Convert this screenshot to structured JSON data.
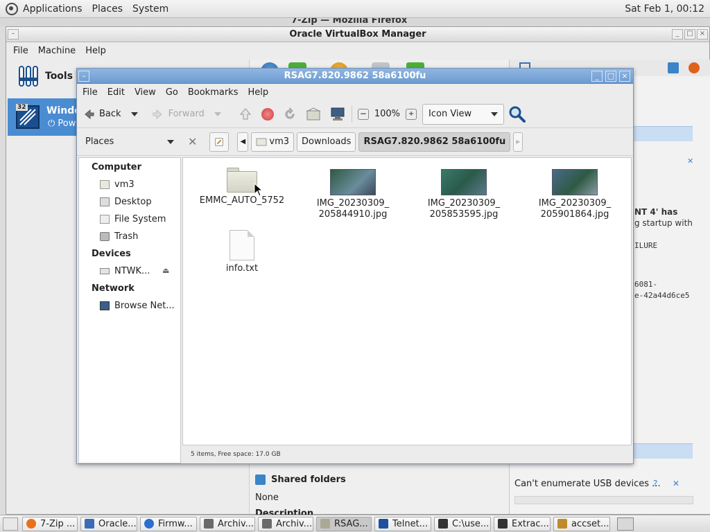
{
  "top_panel": {
    "menus": [
      "Applications",
      "Places",
      "System"
    ],
    "clock": "Sat Feb 1, 00:12"
  },
  "bg_firefox_title": "7-Zip — Mozilla Firefox",
  "vbox": {
    "title": "Oracle VirtualBox Manager",
    "menus": [
      "File",
      "Machine",
      "Help"
    ],
    "tools_label": "Tools",
    "vm": {
      "name": "Windov",
      "state": "Pow",
      "badge": "32"
    },
    "shared_folders_label": "Shared folders",
    "shared_folders_value": "None",
    "description_label": "Description",
    "right_note_1": "NT 4' has",
    "right_note_2": "g startup with",
    "mono_1": "ILURE",
    "mono_2": "6081-",
    "mono_3": "e-42a44d6ce5",
    "usb_message": "Can't enumerate USB devices ..."
  },
  "fm": {
    "title": "RSAG7.820.9862 58a6100fu",
    "menus": [
      "File",
      "Edit",
      "View",
      "Go",
      "Bookmarks",
      "Help"
    ],
    "toolbar": {
      "back": "Back",
      "forward": "Forward",
      "zoom": "100%",
      "view_mode": "Icon View"
    },
    "location": {
      "places_label": "Places",
      "crumbs": [
        "vm3",
        "Downloads",
        "RSAG7.820.9862 58a6100fu"
      ]
    },
    "sidebar": {
      "computer_header": "Computer",
      "computer_items": [
        "vm3",
        "Desktop",
        "File System",
        "Trash"
      ],
      "devices_header": "Devices",
      "devices_items": [
        "NTWK..."
      ],
      "network_header": "Network",
      "network_items": [
        "Browse Net..."
      ]
    },
    "items": [
      {
        "name_1": "EMMC_AUTO_5752",
        "name_2": "",
        "type": "folder"
      },
      {
        "name_1": "IMG_20230309_",
        "name_2": "205844910.jpg",
        "type": "image"
      },
      {
        "name_1": "IMG_20230309_",
        "name_2": "205853595.jpg",
        "type": "image"
      },
      {
        "name_1": "IMG_20230309_",
        "name_2": "205901864.jpg",
        "type": "image"
      },
      {
        "name_1": "info.txt",
        "name_2": "",
        "type": "text"
      }
    ],
    "status": "5 items, Free space: 17.0 GB"
  },
  "taskbar": {
    "tasks": [
      "7-Zip ...",
      "Oracle...",
      "Firmw...",
      "Archiv...",
      "Archiv...",
      "RSAG...",
      "Telnet...",
      "C:\\use...",
      "Extrac...",
      "accset..."
    ],
    "task_icon_colors": [
      "#e8701a",
      "#3a6db5",
      "#2a6fd0",
      "#6a6a6a",
      "#6a6a6a",
      "#a9a996",
      "#1f4fa0",
      "#333333",
      "#333333",
      "#c08a2a"
    ]
  }
}
